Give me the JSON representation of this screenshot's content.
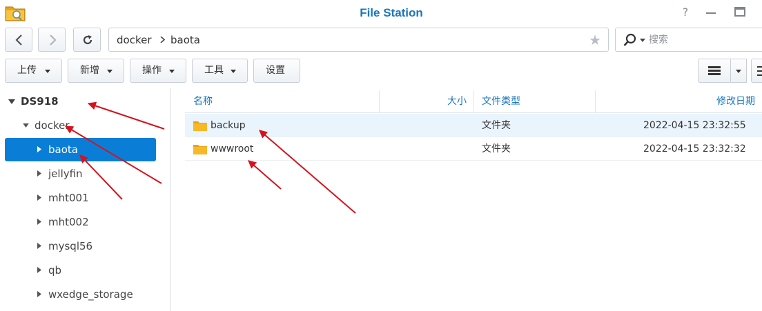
{
  "window": {
    "title": "File Station",
    "help_glyph": "?"
  },
  "nav": {
    "path": [
      "docker",
      "baota"
    ]
  },
  "search": {
    "placeholder": "搜索"
  },
  "toolbar": {
    "upload_label": "上传",
    "create_label": "新增",
    "action_label": "操作",
    "tools_label": "工具",
    "settings_label": "设置"
  },
  "sidebar": {
    "root": "DS918",
    "share": "docker",
    "items": [
      {
        "label": "baota",
        "selected": true
      },
      {
        "label": "jellyfin"
      },
      {
        "label": "mht001"
      },
      {
        "label": "mht002"
      },
      {
        "label": "mysql56"
      },
      {
        "label": "qb"
      },
      {
        "label": "wxedge_storage"
      }
    ]
  },
  "list": {
    "columns": {
      "name": "名称",
      "size": "大小",
      "type": "文件类型",
      "modified": "修改日期"
    },
    "rows": [
      {
        "name": "backup",
        "size": "",
        "type": "文件夹",
        "modified": "2022-04-15 23:32:55",
        "selected": true
      },
      {
        "name": "wwwroot",
        "size": "",
        "type": "文件夹",
        "modified": "2022-04-15 23:32:32"
      }
    ]
  },
  "colors": {
    "accent": "#1a75bc",
    "selection": "#0a7ed6",
    "row_highlight": "#eaf4fd",
    "folder": "#f5b21b",
    "annotation_arrow": "#d6121c"
  },
  "icons": [
    "file-station-app-icon",
    "help-icon",
    "minimize-icon",
    "maximize-icon",
    "back-icon",
    "forward-icon",
    "refresh-icon",
    "breadcrumb-chevron-icon",
    "star-icon",
    "search-icon",
    "list-view-icon",
    "folder-icon",
    "tree-expand-icon",
    "tree-collapse-icon"
  ]
}
